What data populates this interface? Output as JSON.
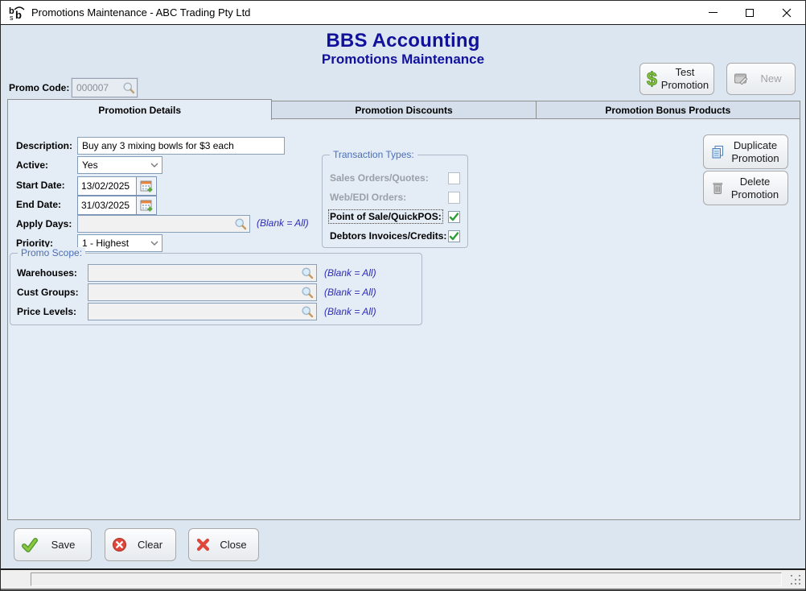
{
  "window": {
    "title": "Promotions Maintenance - ABC Trading Pty Ltd"
  },
  "header": {
    "app_title": "BBS Accounting",
    "page_title": "Promotions Maintenance"
  },
  "toolbar": {
    "test_promotion_label": "Test Promotion",
    "new_label": "New"
  },
  "promo_code": {
    "label": "Promo Code:",
    "value": "000007"
  },
  "tabs": [
    {
      "label": "Promotion Details",
      "active": true
    },
    {
      "label": "Promotion Discounts",
      "active": false
    },
    {
      "label": "Promotion Bonus Products",
      "active": false
    }
  ],
  "fields": {
    "description": {
      "label": "Description:",
      "value": "Buy any 3 mixing bowls for $3 each"
    },
    "active": {
      "label": "Active:",
      "value": "Yes"
    },
    "start_date": {
      "label": "Start Date:",
      "value": "13/02/2025"
    },
    "end_date": {
      "label": "End Date:",
      "value": "31/03/2025"
    },
    "apply_days": {
      "label": "Apply Days:",
      "value": "",
      "hint": "(Blank = All)"
    },
    "priority": {
      "label": "Priority:",
      "value": "1 - Highest"
    }
  },
  "transaction_types": {
    "title": "Transaction Types:",
    "items": [
      {
        "label": "Sales Orders/Quotes:",
        "checked": false,
        "enabled": false
      },
      {
        "label": "Web/EDI Orders:",
        "checked": false,
        "enabled": false
      },
      {
        "label": "Point of Sale/QuickPOS:",
        "checked": true,
        "enabled": true,
        "focused": true
      },
      {
        "label": "Debtors Invoices/Credits:",
        "checked": true,
        "enabled": true
      }
    ]
  },
  "promo_scope": {
    "title": "Promo Scope:",
    "items": [
      {
        "label": "Warehouses:",
        "value": "",
        "hint": "(Blank = All)"
      },
      {
        "label": "Cust Groups:",
        "value": "",
        "hint": "(Blank = All)"
      },
      {
        "label": "Price Levels:",
        "value": "",
        "hint": "(Blank = All)"
      }
    ]
  },
  "side_buttons": {
    "duplicate_label": "Duplicate Promotion",
    "delete_label": "Delete Promotion"
  },
  "footer_buttons": {
    "save_label": "Save",
    "clear_label": "Clear",
    "close_label": "Close"
  },
  "colors": {
    "heading": "#11119b",
    "group_title": "#4a6fb5",
    "hint_text": "#2d2db2",
    "check_green": "#2e9e36",
    "danger_red": "#e0473a",
    "save_green": "#8dc63f",
    "content_bg": "#dce6f1"
  }
}
